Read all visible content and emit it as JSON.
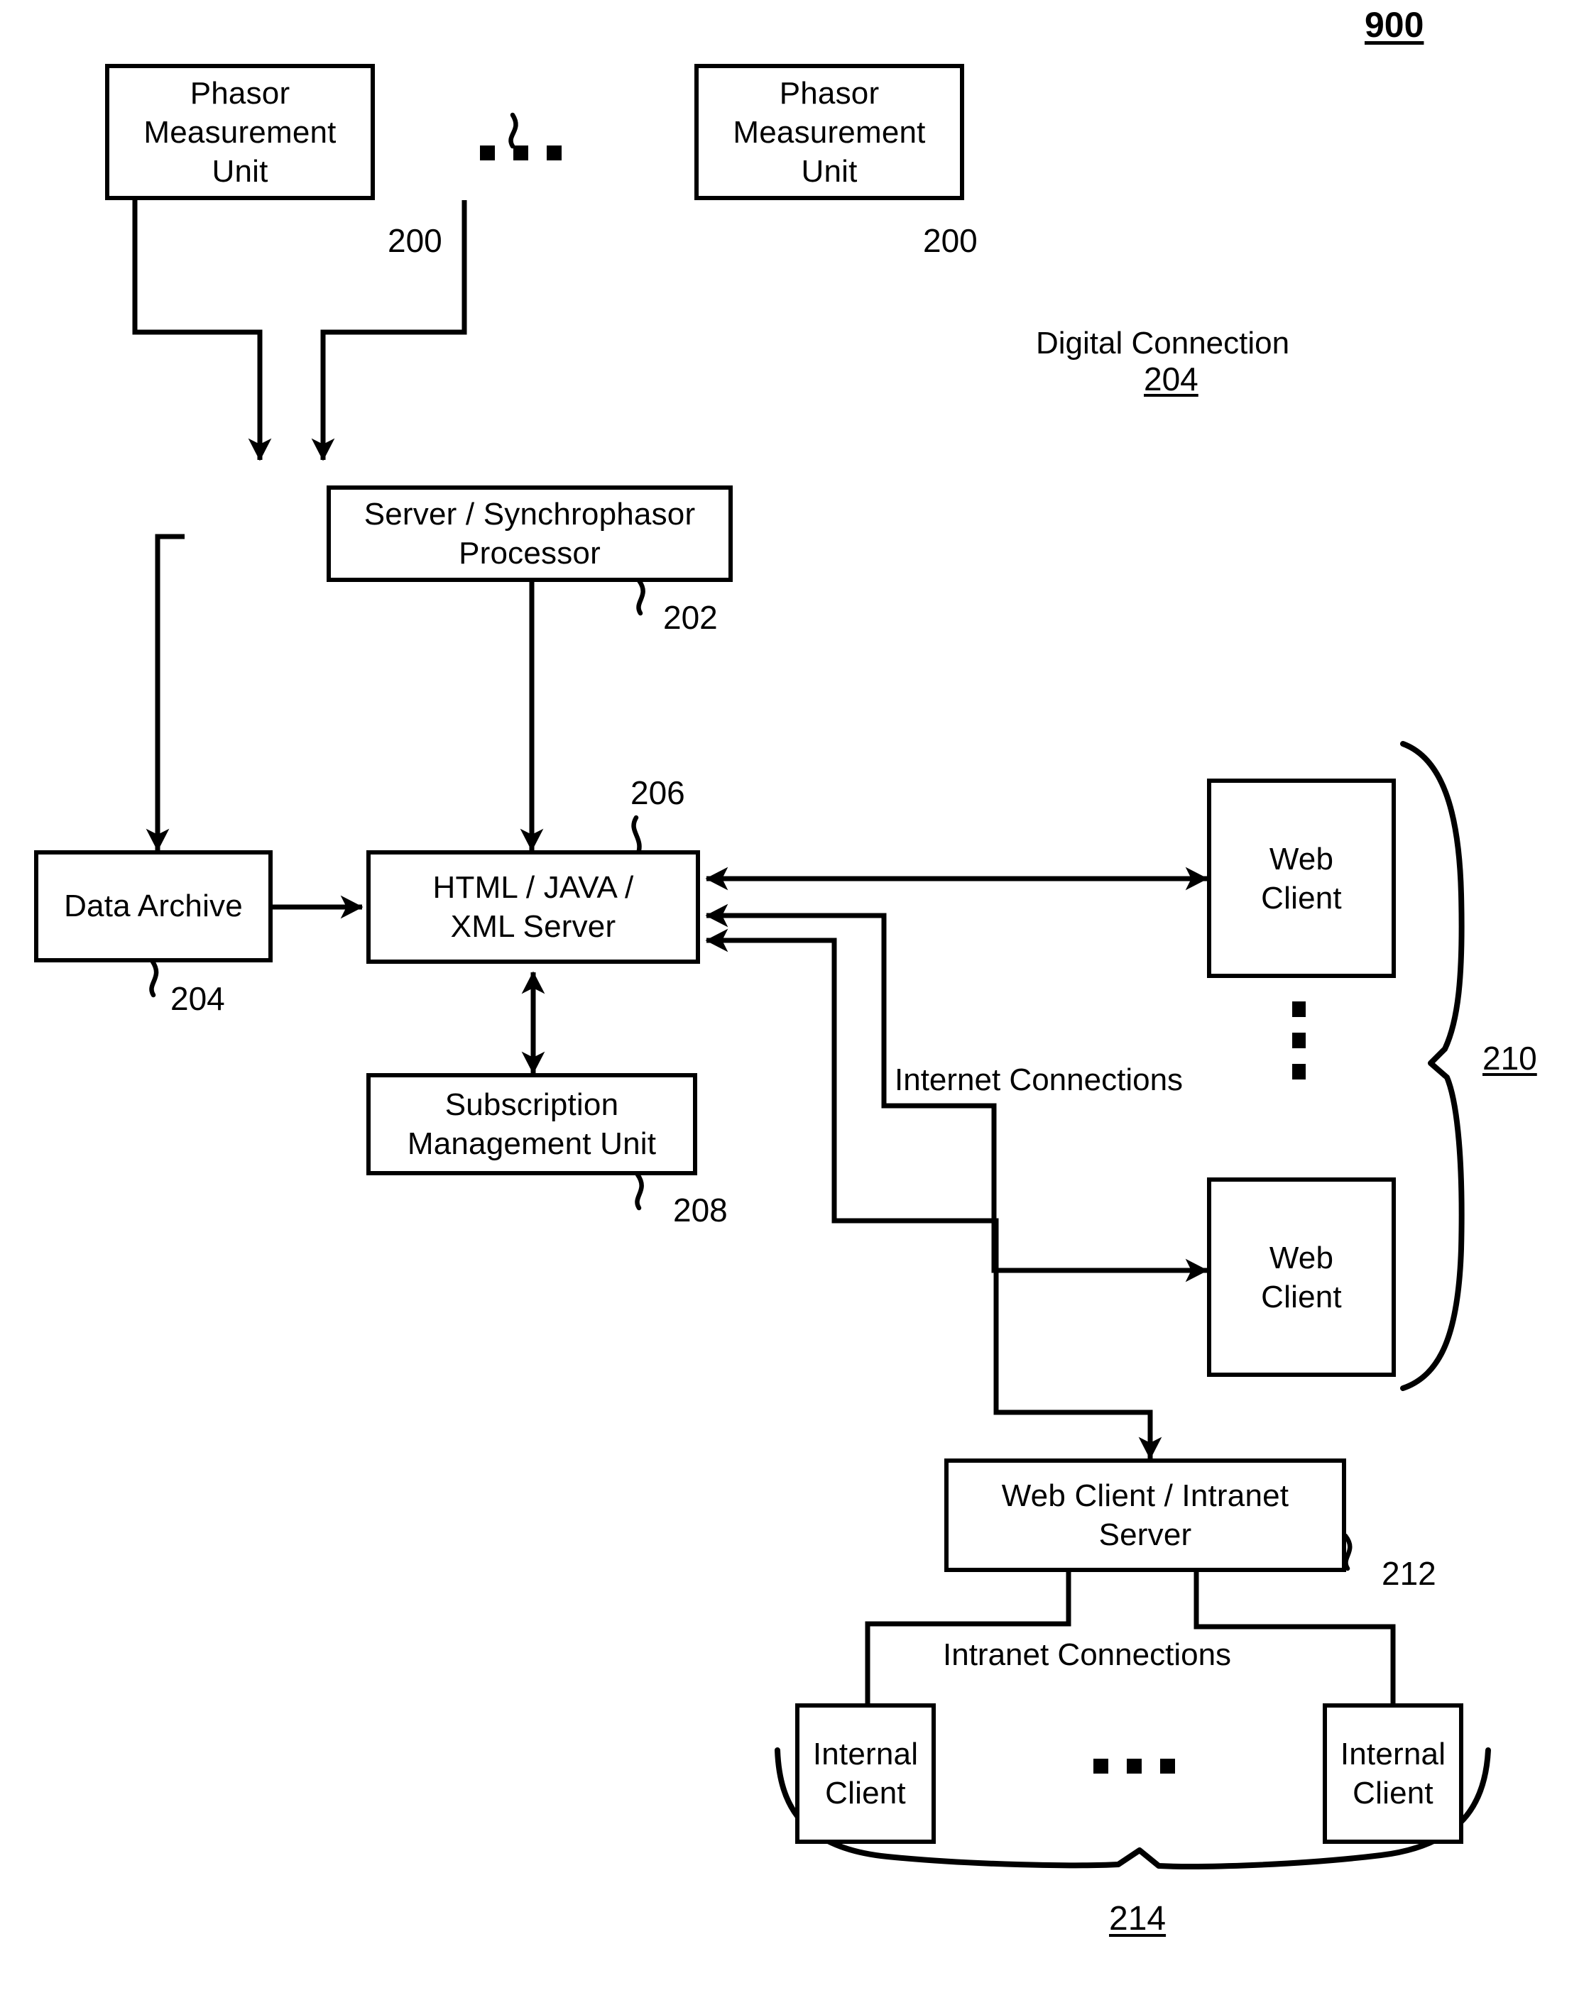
{
  "figure": {
    "number": "900"
  },
  "nodes": {
    "pmu_left": {
      "line1": "Phasor",
      "line2": "Measurement",
      "line3": "Unit",
      "ref": "200"
    },
    "pmu_right": {
      "line1": "Phasor",
      "line2": "Measurement",
      "line3": "Unit",
      "ref": "200"
    },
    "server_processor": {
      "line1": "Server / Synchrophasor",
      "line2": "Processor",
      "ref": "202"
    },
    "data_archive": {
      "line1": "Data Archive",
      "ref": "204"
    },
    "xml_server": {
      "line1": "HTML / JAVA /",
      "line2": "XML Server",
      "ref": "206"
    },
    "subscription_unit": {
      "line1": "Subscription",
      "line2": "Management Unit",
      "ref": "208"
    },
    "web_client_top": {
      "line1": "Web",
      "line2": "Client"
    },
    "web_client_bottom": {
      "line1": "Web",
      "line2": "Client"
    },
    "intranet_server": {
      "line1": "Web Client / Intranet",
      "line2": "Server",
      "ref": "212"
    },
    "internal_client_left": {
      "line1": "Internal",
      "line2": "Client"
    },
    "internal_client_right": {
      "line1": "Internal",
      "line2": "Client"
    }
  },
  "labels": {
    "digital_connection": "Digital Connection",
    "digital_connection_ref": "204",
    "internet_connections": "Internet Connections",
    "intranet_connections": "Intranet Connections",
    "web_clients_group_ref": "210",
    "internal_clients_group_ref": "214"
  },
  "colors": {
    "stroke": "#000000",
    "background": "#ffffff"
  }
}
